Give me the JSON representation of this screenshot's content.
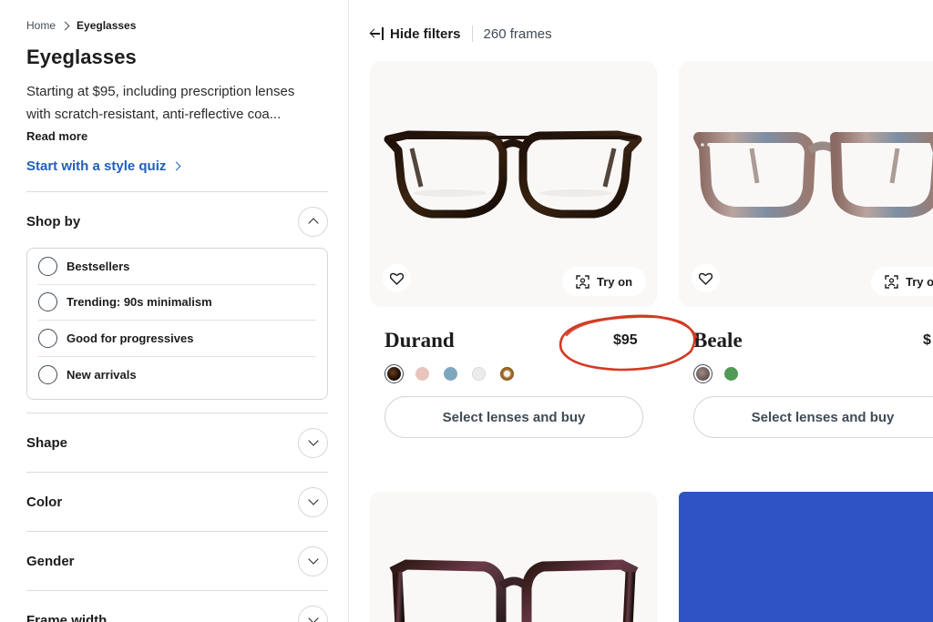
{
  "breadcrumb": {
    "home": "Home",
    "current": "Eyeglasses"
  },
  "page": {
    "title": "Eyeglasses",
    "intro_line1": "Starting at $95, including prescription lenses",
    "intro_line2": "with scratch-resistant, anti-reflective coa...",
    "read_more": "Read more",
    "quiz_link": "Start with a style quiz"
  },
  "filters": {
    "shop_by": {
      "label": "Shop by",
      "expanded": true,
      "options": [
        "Bestsellers",
        "Trending: 90s minimalism",
        "Good for progressives",
        "New arrivals"
      ]
    },
    "sections": [
      "Shape",
      "Color",
      "Gender",
      "Frame width"
    ]
  },
  "toolbar": {
    "hide_filters": "Hide filters",
    "count": "260 frames"
  },
  "products": [
    {
      "name": "Durand",
      "price": "$95",
      "try_on": "Try on",
      "buy": "Select lenses and buy",
      "swatches": [
        "#3a2418",
        "#e8c4bd",
        "#7fa6bf",
        "#ececec",
        "#b07a2e"
      ],
      "selected_swatch": 0
    },
    {
      "name": "Beale",
      "price": "$",
      "try_on": "Try o",
      "buy": "Select lenses and buy",
      "swatches": [
        "#7a6a66",
        "#4f9a55"
      ],
      "selected_swatch": 0
    }
  ],
  "colors": {
    "accent_link": "#2160b8",
    "annotation": "#d23b24",
    "promo": "#2e53c2"
  }
}
